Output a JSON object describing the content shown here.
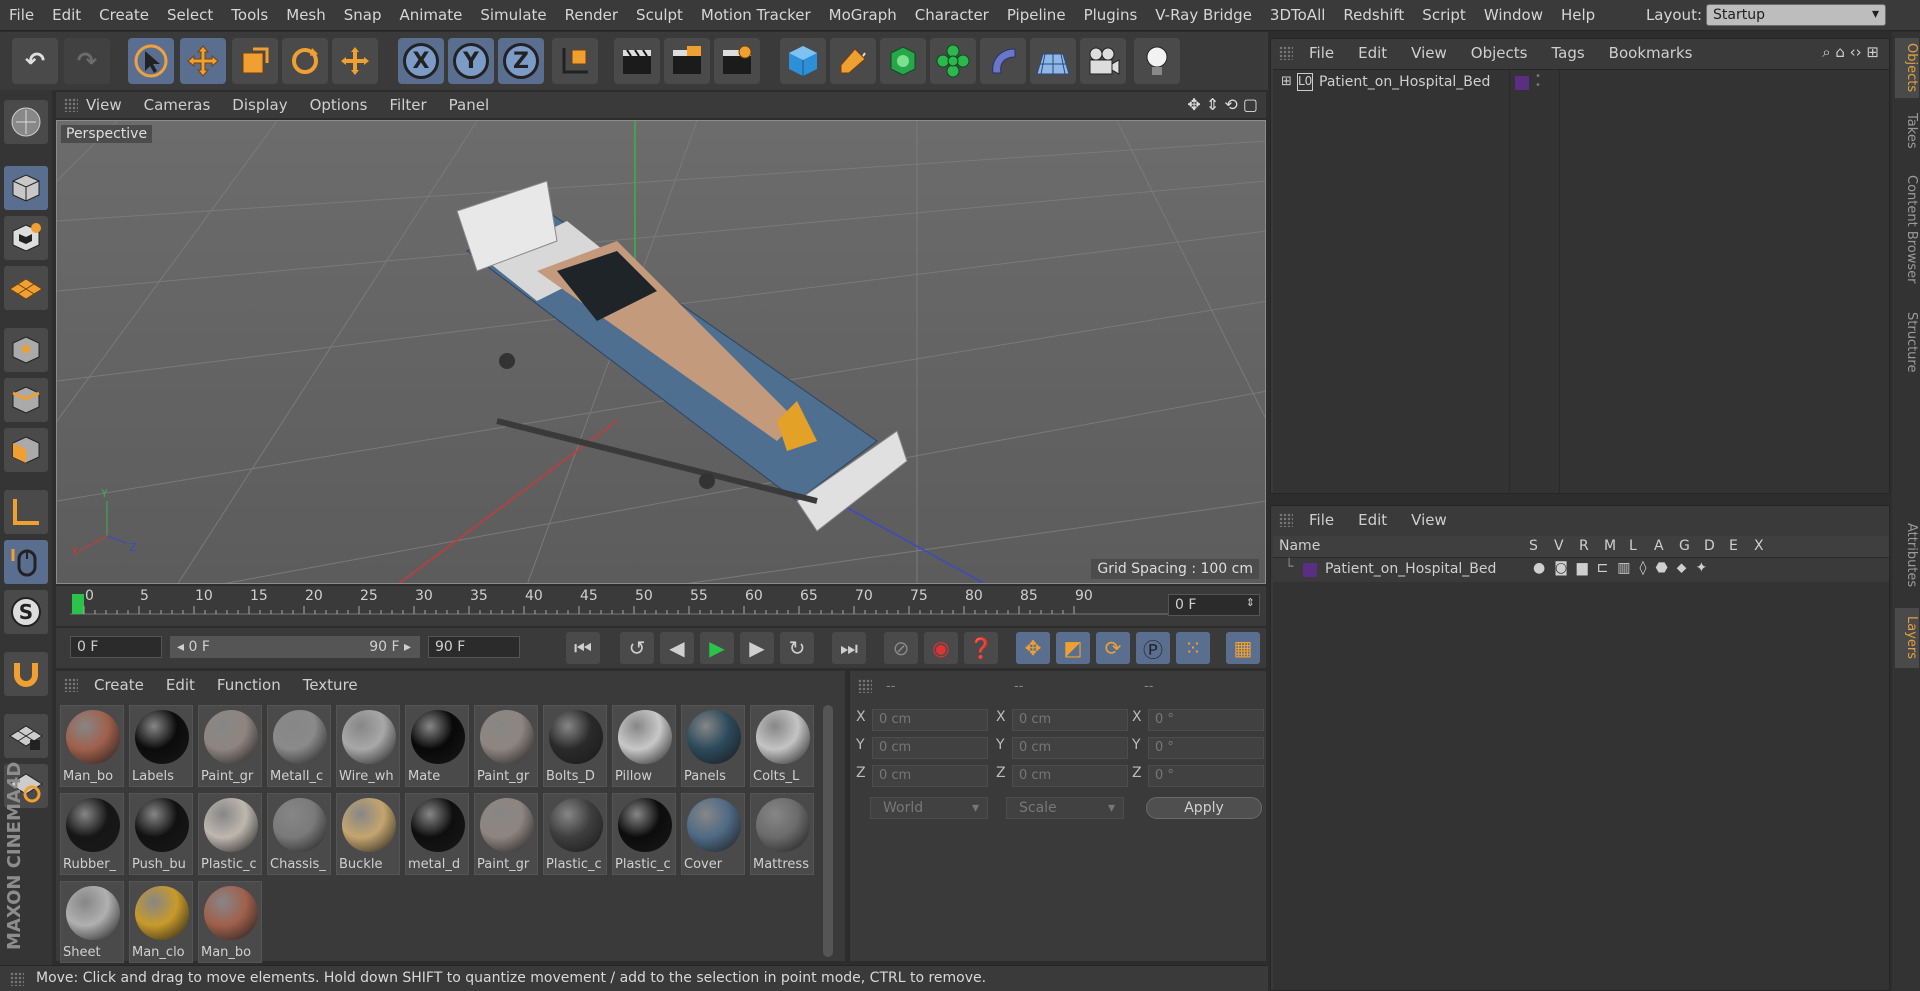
{
  "menubar": {
    "items": [
      "File",
      "Edit",
      "Create",
      "Select",
      "Tools",
      "Mesh",
      "Snap",
      "Animate",
      "Simulate",
      "Render",
      "Sculpt",
      "Motion Tracker",
      "MoGraph",
      "Character",
      "Pipeline",
      "Plugins",
      "V-Ray Bridge",
      "3DToAll",
      "Redshift",
      "Script",
      "Window",
      "Help"
    ],
    "layout_label": "Layout:",
    "layout_value": "Startup"
  },
  "toolbar": {
    "undo": "↶",
    "redo": "↷",
    "axis_x": "X",
    "axis_y": "Y",
    "axis_z": "Z"
  },
  "viewport": {
    "menu": [
      "View",
      "Cameras",
      "Display",
      "Options",
      "Filter",
      "Panel"
    ],
    "camera_label": "Perspective",
    "grid_spacing": "Grid Spacing : 100 cm",
    "axis_labels": {
      "x": "X",
      "y": "Y",
      "z": "Z"
    }
  },
  "timeline": {
    "ticks": [
      "0",
      "5",
      "10",
      "15",
      "20",
      "25",
      "30",
      "35",
      "40",
      "45",
      "50",
      "55",
      "60",
      "65",
      "70",
      "75",
      "80",
      "85",
      "90"
    ],
    "current_frame": "0 F"
  },
  "transport": {
    "start_frame": "0 F",
    "range_start": "◂ 0 F",
    "range_end": "90 F ▸",
    "end_frame": "90 F"
  },
  "materials": {
    "menu": [
      "Create",
      "Edit",
      "Function",
      "Texture"
    ],
    "items": [
      {
        "name": "Man_bo",
        "color": "#a0604c"
      },
      {
        "name": "Labels",
        "color": "#0b0b0b"
      },
      {
        "name": "Paint_gr",
        "color": "#8f8580"
      },
      {
        "name": "Metall_c",
        "color": "#8a8a8a"
      },
      {
        "name": "Wire_wh",
        "color": "#a8a8a8"
      },
      {
        "name": "Mate",
        "color": "#080808"
      },
      {
        "name": "Paint_gr",
        "color": "#8f8580"
      },
      {
        "name": "Bolts_D",
        "color": "#2a2a2a"
      },
      {
        "name": "Pillow",
        "color": "#c8c8c8"
      },
      {
        "name": "Panels",
        "color": "#2c4a5c"
      },
      {
        "name": "Colts_L",
        "color": "#c4c4c4"
      },
      {
        "name": "Rubber_",
        "color": "#161616"
      },
      {
        "name": "Push_bu",
        "color": "#111111"
      },
      {
        "name": "Plastic_c",
        "color": "#bdb7ae"
      },
      {
        "name": "Chassis_",
        "color": "#7a7a7a"
      },
      {
        "name": "Buckle",
        "color": "#c4a56e"
      },
      {
        "name": "metal_d",
        "color": "#0e0e0e"
      },
      {
        "name": "Paint_gr",
        "color": "#8f8580"
      },
      {
        "name": "Plastic_c",
        "color": "#3e3e3e"
      },
      {
        "name": "Plastic_c",
        "color": "#0c0c0c"
      },
      {
        "name": "Cover",
        "color": "#4f6a85"
      },
      {
        "name": "Mattress",
        "color": "#6b6b6b"
      },
      {
        "name": "Sheet",
        "color": "#b0b0b0"
      },
      {
        "name": "Man_clo",
        "color": "#c89a2a"
      },
      {
        "name": "Man_bo",
        "color": "#a0604c"
      }
    ]
  },
  "coords": {
    "headers": [
      "--",
      "--",
      "--"
    ],
    "rows": [
      {
        "a": "X",
        "pos": "0 cm",
        "b": "X",
        "size": "0 cm",
        "c": "X",
        "rot": "0 °"
      },
      {
        "a": "Y",
        "pos": "0 cm",
        "b": "Y",
        "size": "0 cm",
        "c": "Y",
        "rot": "0 °"
      },
      {
        "a": "Z",
        "pos": "0 cm",
        "b": "Z",
        "size": "0 cm",
        "c": "Z",
        "rot": "0 °"
      }
    ],
    "space": "World",
    "mode": "Scale",
    "apply": "Apply"
  },
  "objects": {
    "menu": [
      "File",
      "Edit",
      "View",
      "Objects",
      "Tags",
      "Bookmarks"
    ],
    "items": [
      {
        "name": "Patient_on_Hospital_Bed",
        "layer_color": "#5a2e82"
      }
    ]
  },
  "layers": {
    "menu": [
      "File",
      "Edit",
      "View"
    ],
    "columns": [
      "Name",
      "S",
      "V",
      "R",
      "M",
      "L",
      "A",
      "G",
      "D",
      "E",
      "X"
    ],
    "rows": [
      {
        "name": "Patient_on_Hospital_Bed",
        "color": "#5a2e82"
      }
    ]
  },
  "sidetabs": {
    "top": [
      "Objects",
      "Takes",
      "Content Browser",
      "Structure"
    ],
    "bottom": [
      "Attributes",
      "Layers"
    ]
  },
  "status": {
    "text": "Move: Click and drag to move elements. Hold down SHIFT to quantize movement / add to the selection in point mode, CTRL to remove."
  },
  "branding": {
    "logo": "MAXON CINEMA4D"
  },
  "colors": {
    "accent": "#e0a040",
    "selected": "#5a6f8f",
    "axis_x": "#c83a3a",
    "axis_y": "#3ab04a",
    "axis_z": "#3a4ac8"
  }
}
